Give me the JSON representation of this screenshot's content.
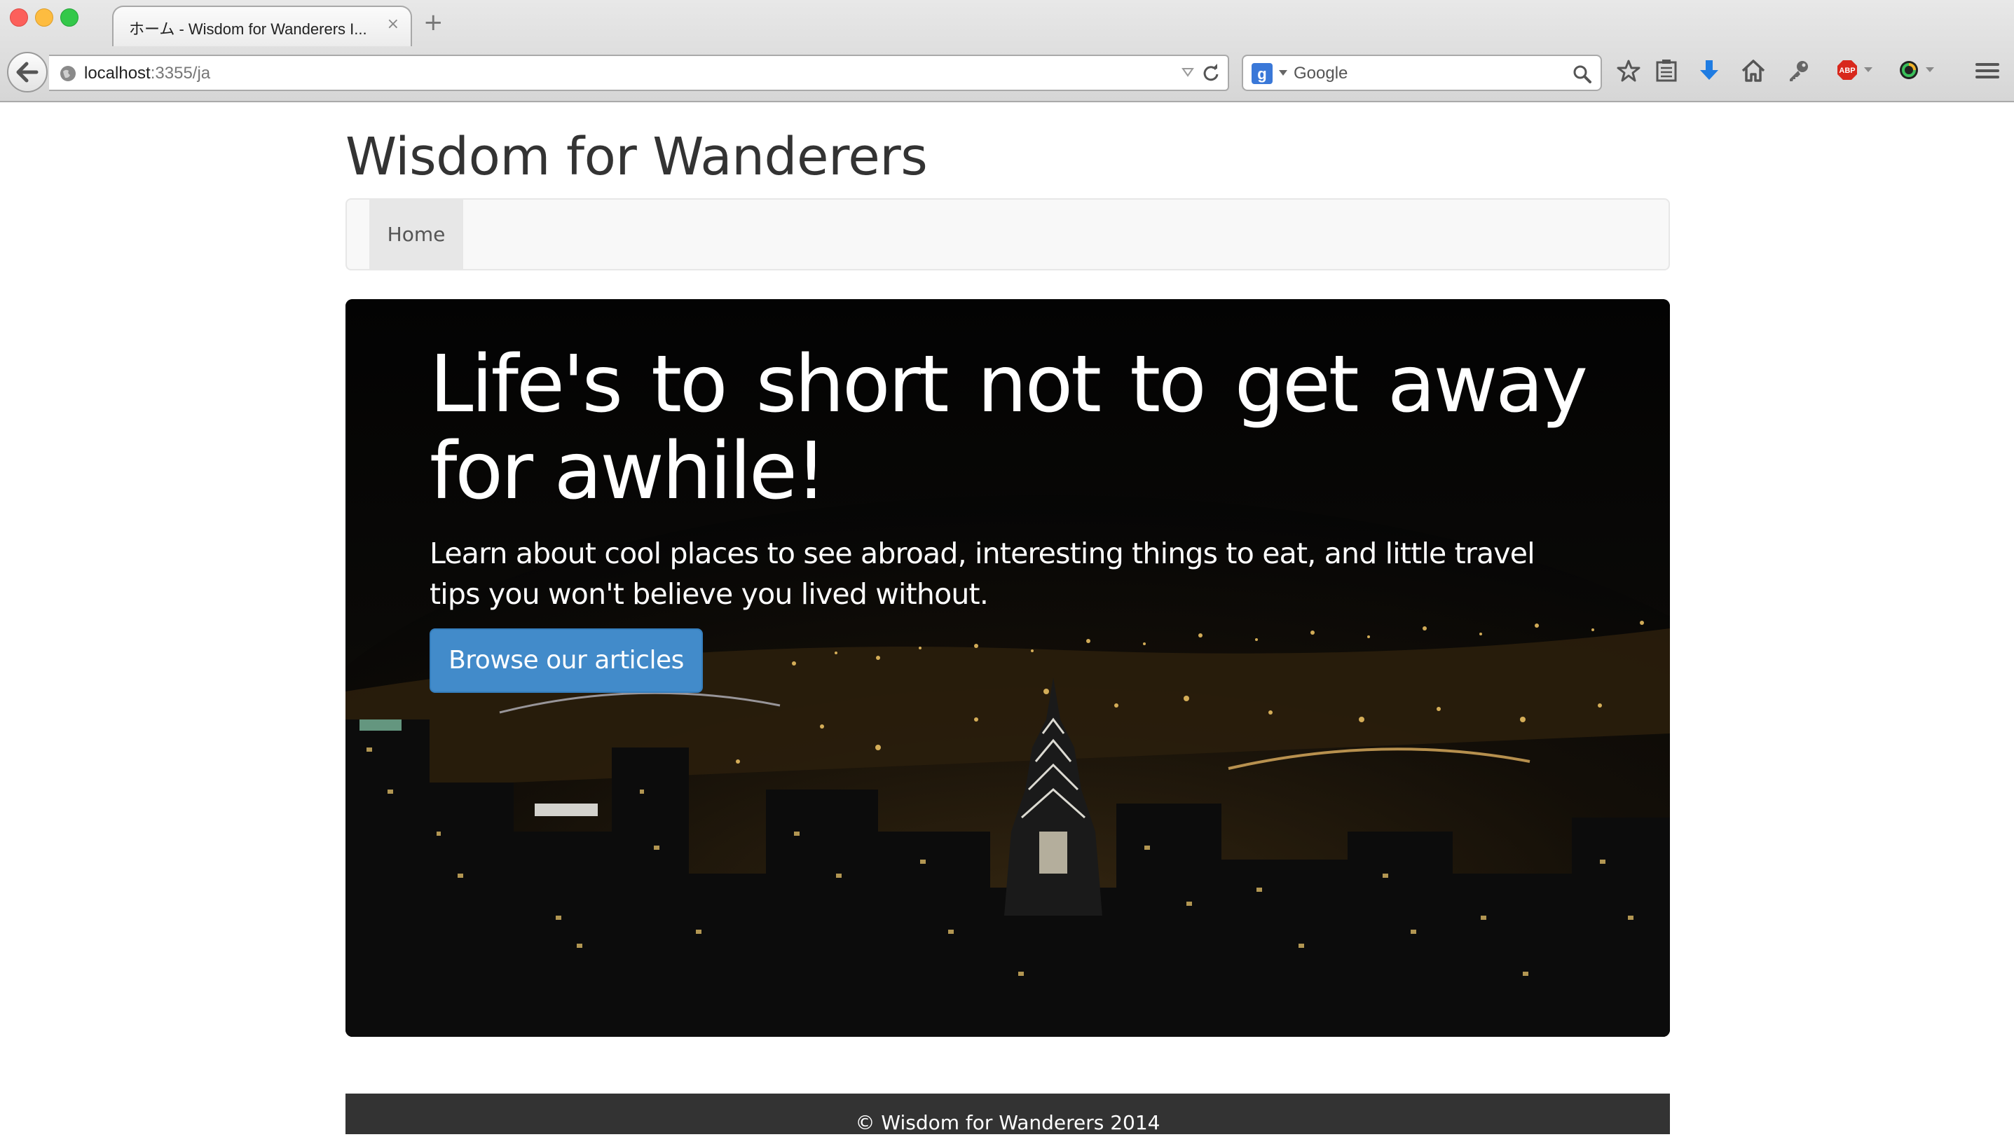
{
  "browser": {
    "tab_title": "ホーム - Wisdom for Wanderers I...",
    "tab_close": "×",
    "new_tab": "+",
    "url_host": "localhost",
    "url_rest": ":3355/ja",
    "search_placeholder": "Google",
    "toolbar_icons": [
      "bookmark-star-icon",
      "reading-list-icon",
      "downloads-icon",
      "home-icon",
      "key-icon",
      "adblock-icon",
      "color-picker-icon",
      "menu-icon"
    ]
  },
  "site": {
    "title": "Wisdom for Wanderers",
    "nav": {
      "items": [
        {
          "label": "Home",
          "active": true
        }
      ]
    }
  },
  "hero": {
    "headline": "Life's to short not to get away for awhile!",
    "lead": "Learn about cool places to see abroad, interesting things to eat, and little travel tips you won't believe you lived without.",
    "cta_label": "Browse our articles"
  },
  "footer": {
    "text": "© Wisdom for Wanderers 2014"
  },
  "colors": {
    "primary_button": "#428bca",
    "footer_bg": "#333333",
    "nav_bg": "#f8f8f8",
    "nav_active_bg": "#e7e7e7"
  }
}
